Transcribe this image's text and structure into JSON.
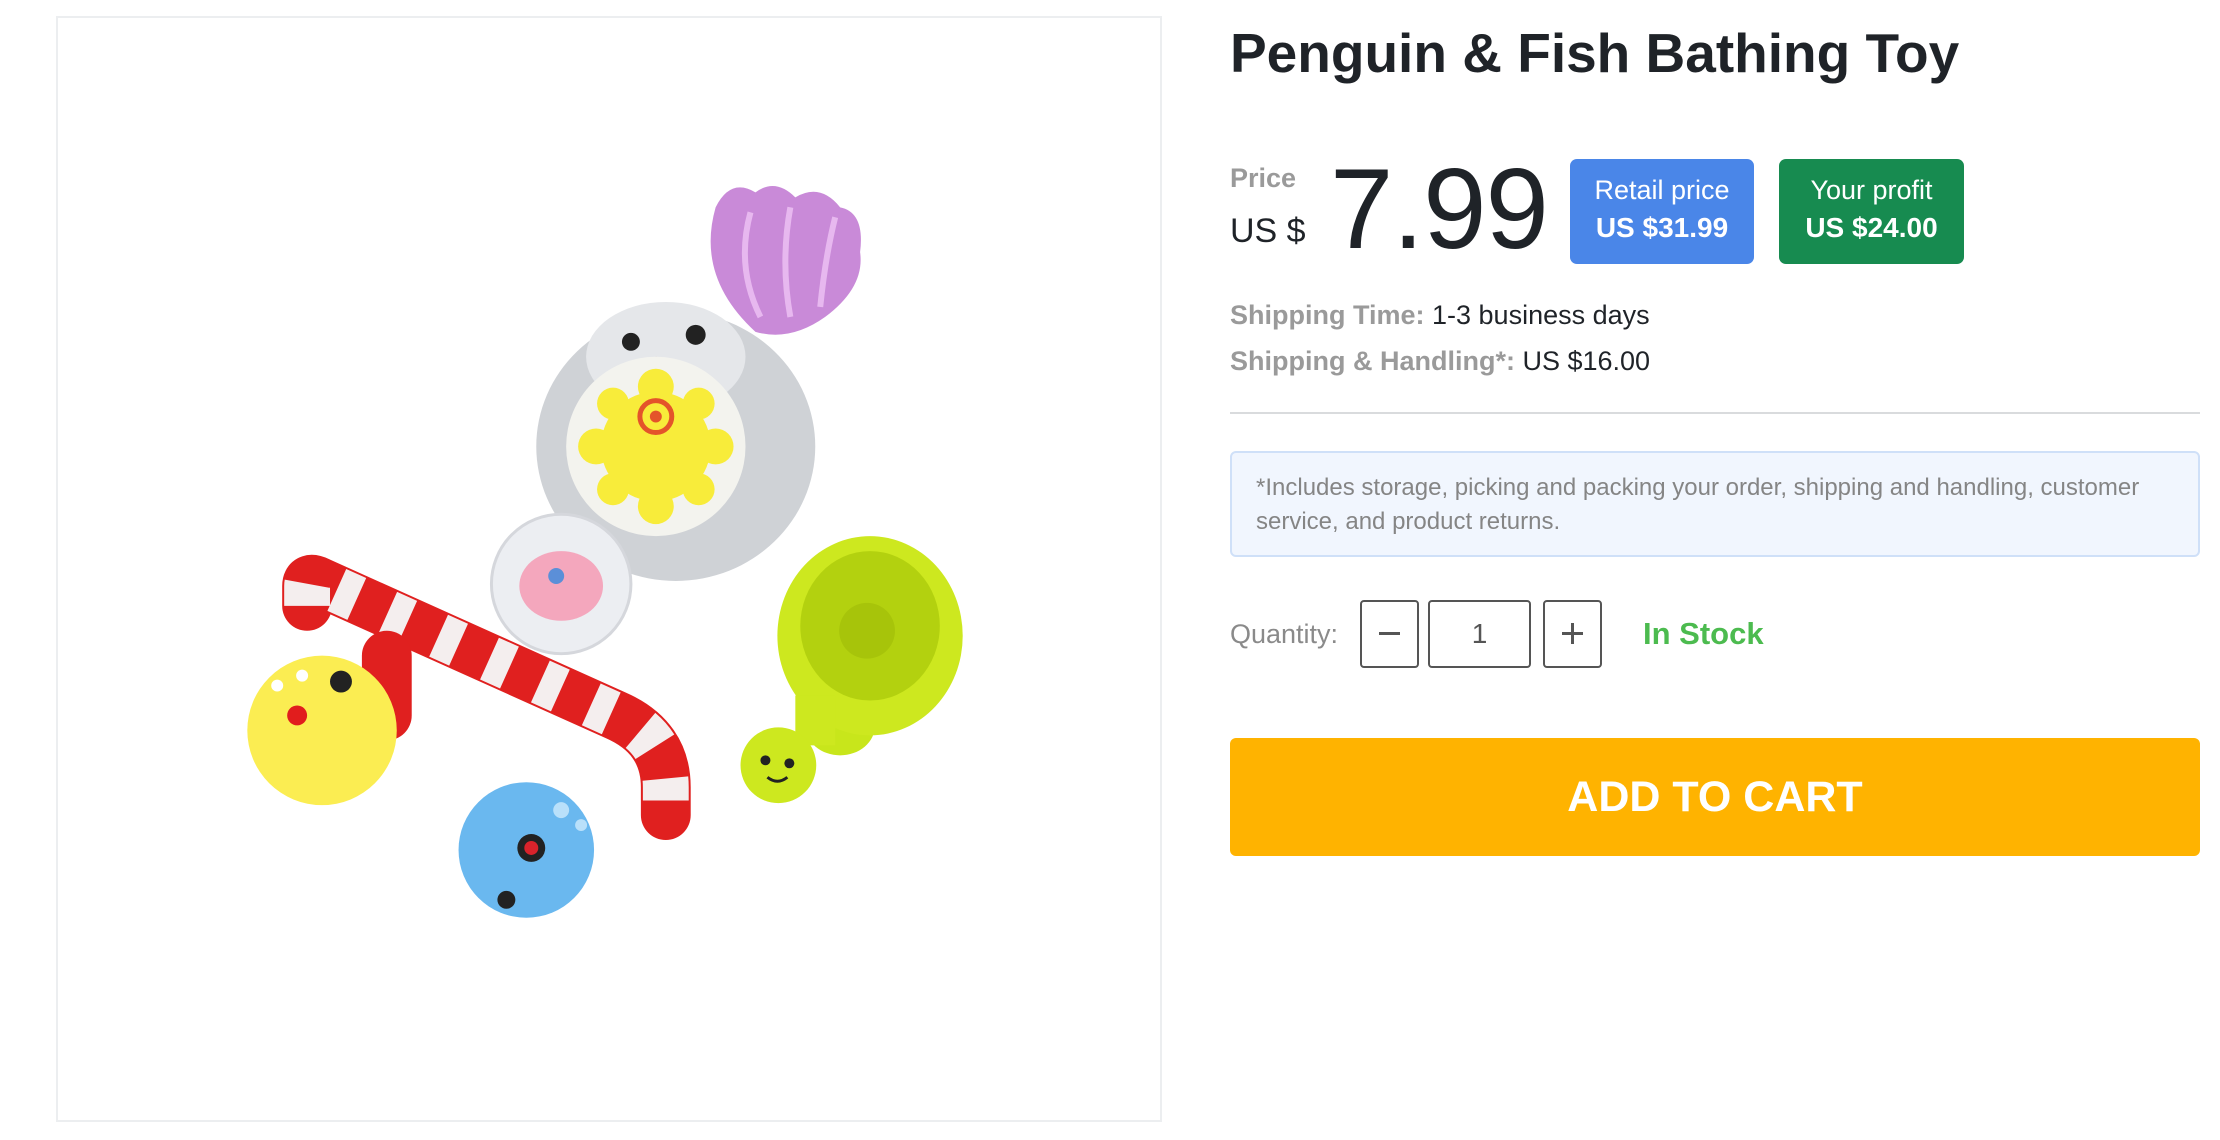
{
  "product": {
    "title": "Penguin & Fish Bathing Toy",
    "image_alt": "Penguin & Fish Bathing Toy"
  },
  "price": {
    "label": "Price",
    "currency": "US $",
    "value": "7.99"
  },
  "badges": {
    "retail_label": "Retail price",
    "retail_value": "US $31.99",
    "profit_label": "Your profit",
    "profit_value": "US $24.00"
  },
  "shipping": {
    "time_label": "Shipping Time:",
    "time_value": "1-3 business days",
    "handling_label": "Shipping & Handling*:",
    "handling_value": "US $16.00"
  },
  "note": "*Includes storage, picking and packing your order, shipping and handling, customer service, and product returns.",
  "quantity": {
    "label": "Quantity:",
    "value": "1"
  },
  "stock_status": "In Stock",
  "cart_button": "ADD TO CART",
  "colors": {
    "retail_badge": "#4a86e8",
    "profit_badge": "#178b50",
    "in_stock": "#4cbb4f",
    "add_to_cart": "#ffb300"
  },
  "icons": {
    "decrease": "minus-icon",
    "increase": "plus-icon"
  }
}
